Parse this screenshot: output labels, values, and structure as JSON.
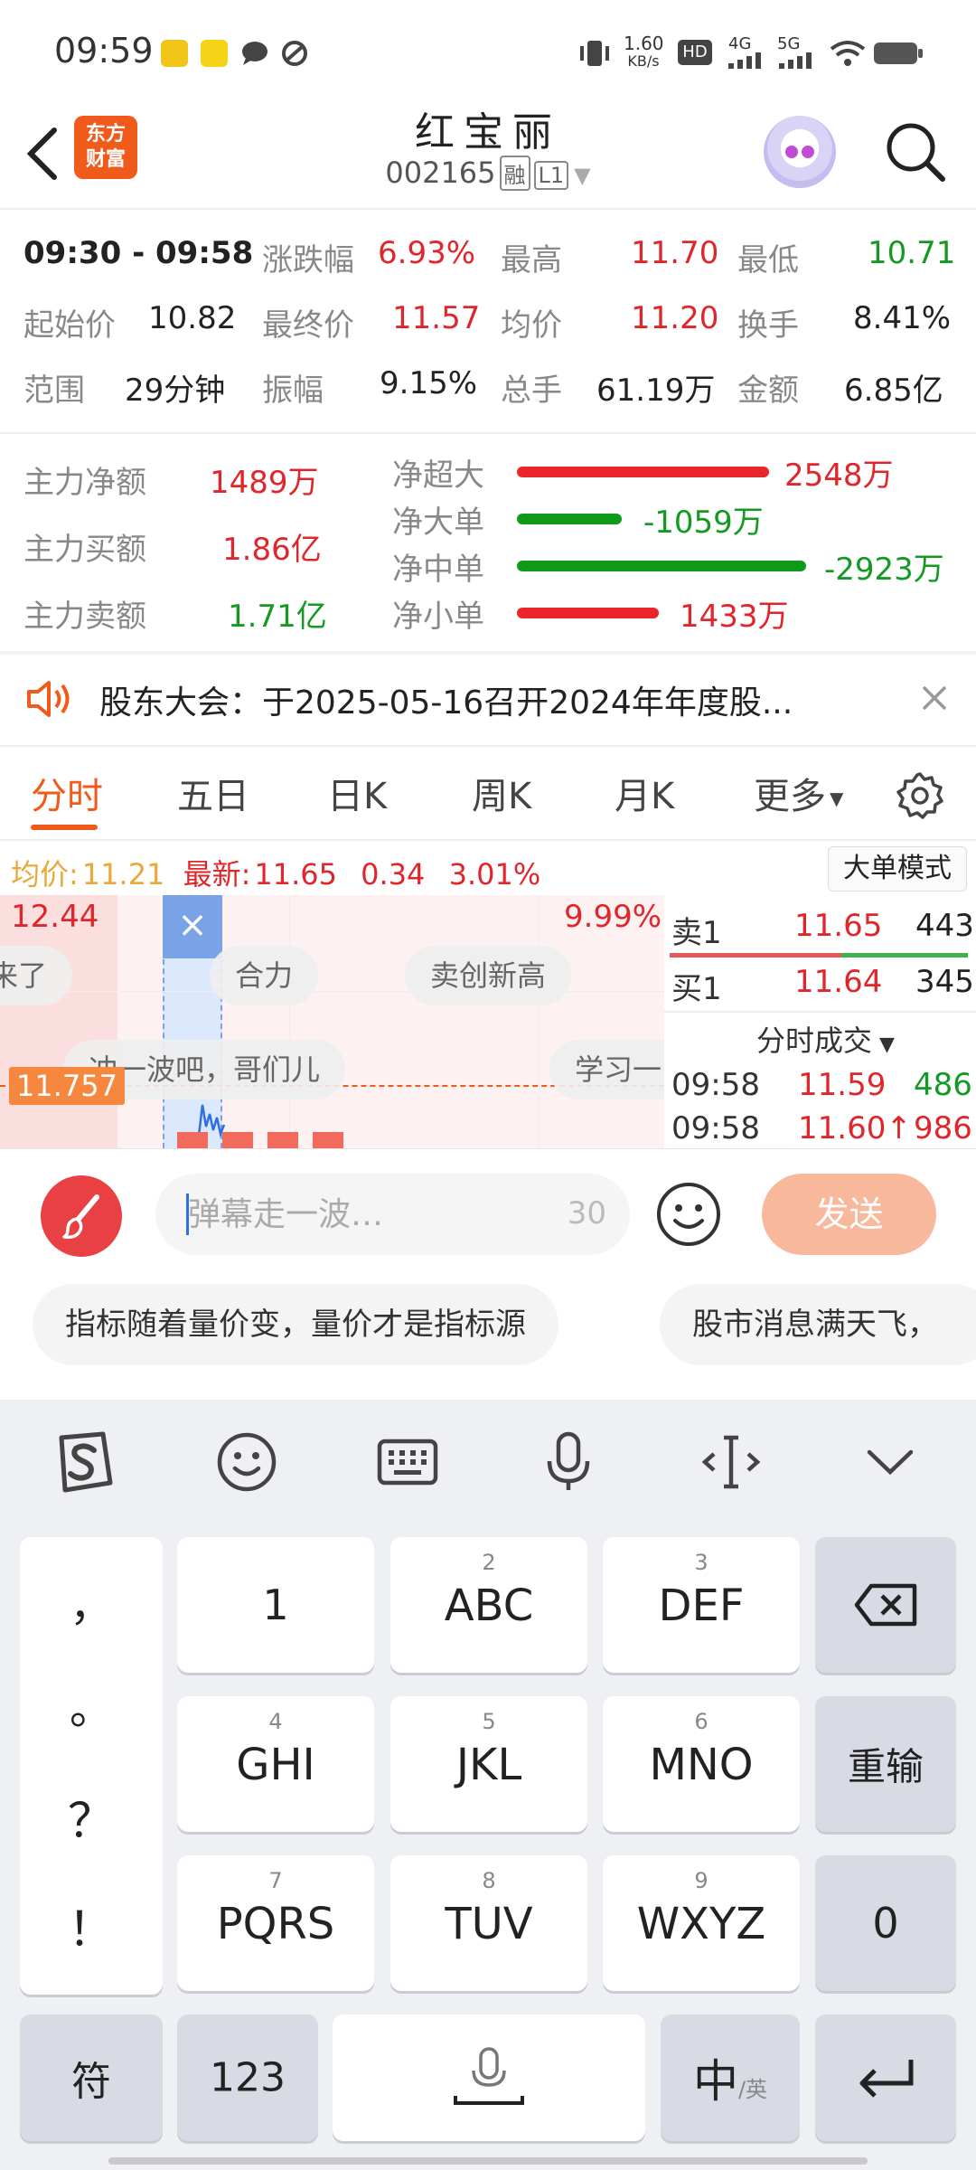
{
  "status_bar": {
    "time": "09:59",
    "net_speed": "1.60",
    "net_unit": "KB/s",
    "hd_label": "HD",
    "signal_4g": "4G",
    "signal_5g": "5G"
  },
  "header": {
    "logo_line1": "东方",
    "logo_line2": "财富",
    "stock_name": "红宝丽",
    "stock_code": "002165",
    "tag_rong": "融",
    "tag_level": "L1"
  },
  "stats": {
    "period": "09:30 - 09:58",
    "rows": [
      [
        {
          "label": "涨跌幅",
          "value": "6.93%",
          "color": "red"
        },
        {
          "label": "最高",
          "value": "11.70",
          "color": "red"
        },
        {
          "label": "最低",
          "value": "10.71",
          "color": "green"
        }
      ],
      [
        {
          "label": "起始价",
          "value": "10.82",
          "color": "dark"
        },
        {
          "label": "最终价",
          "value": "11.57",
          "color": "red"
        },
        {
          "label": "均价",
          "value": "11.20",
          "color": "red"
        },
        {
          "label": "换手",
          "value": "8.41%",
          "color": "dark"
        }
      ],
      [
        {
          "label": "范围",
          "value": "29分钟",
          "color": "dark"
        },
        {
          "label": "振幅",
          "value": "9.15%",
          "color": "dark"
        },
        {
          "label": "总手",
          "value": "61.19万",
          "color": "dark"
        },
        {
          "label": "金额",
          "value": "6.85亿",
          "color": "dark"
        }
      ]
    ]
  },
  "fund_flow": {
    "main": [
      {
        "label": "主力净额",
        "value": "1489万",
        "color": "red"
      },
      {
        "label": "主力买额",
        "value": "1.86亿",
        "color": "red"
      },
      {
        "label": "主力卖额",
        "value": "1.71亿",
        "color": "green"
      }
    ],
    "breakdown": [
      {
        "label": "净超大",
        "value": "2548万",
        "amount": 2548,
        "color": "#e8262b"
      },
      {
        "label": "净大单",
        "value": "-1059万",
        "amount": -1059,
        "color": "#109a1a"
      },
      {
        "label": "净中单",
        "value": "-2923万",
        "amount": -2923,
        "color": "#109a1a"
      },
      {
        "label": "净小单",
        "value": "1433万",
        "amount": 1433,
        "color": "#e8262b"
      }
    ]
  },
  "notice": {
    "text": "股东大会：于2025-05-16召开2024年年度股..."
  },
  "tabs": [
    {
      "label": "分时",
      "active": true
    },
    {
      "label": "五日",
      "active": false
    },
    {
      "label": "日K",
      "active": false
    },
    {
      "label": "周K",
      "active": false
    },
    {
      "label": "月K",
      "active": false
    },
    {
      "label": "更多",
      "active": false
    }
  ],
  "quote_line": {
    "avg_label": "均价:",
    "avg_value": "11.21",
    "latest_label": "最新:",
    "latest_value": "11.65",
    "change": "0.34",
    "change_pct": "3.01%",
    "mode_button": "大单模式"
  },
  "chart": {
    "top_price": "12.44",
    "top_pct": "9.99%",
    "marker_price": "11.757",
    "danmu": [
      "来了",
      "合力",
      "卖创新高",
      "冲一波吧，哥们儿",
      "学习一"
    ]
  },
  "order_book": {
    "sell": {
      "label": "卖1",
      "price": "11.65",
      "volume": "443"
    },
    "buy": {
      "label": "买1",
      "price": "11.64",
      "volume": "345"
    },
    "trades_title": "分时成交",
    "trades": [
      {
        "time": "09:58",
        "price": "11.59",
        "volume": "486",
        "vol_color": "green"
      },
      {
        "time": "09:58",
        "price": "11.60↑",
        "volume": "986",
        "vol_color": "red"
      }
    ]
  },
  "danmu_input": {
    "placeholder": "弹幕走一波…",
    "char_limit": "30",
    "send_label": "发送"
  },
  "quick_chips": [
    "指标随着量价变，量价才是指标源",
    "股市消息满天飞，"
  ],
  "keyboard": {
    "punct_keys": [
      "，",
      "。",
      "？",
      "！"
    ],
    "rows": [
      [
        {
          "num": "",
          "label": "1"
        },
        {
          "num": "2",
          "label": "ABC"
        },
        {
          "num": "3",
          "label": "DEF"
        }
      ],
      [
        {
          "num": "4",
          "label": "GHI"
        },
        {
          "num": "5",
          "label": "JKL"
        },
        {
          "num": "6",
          "label": "MNO"
        }
      ],
      [
        {
          "num": "7",
          "label": "PQRS"
        },
        {
          "num": "8",
          "label": "TUV"
        },
        {
          "num": "9",
          "label": "WXYZ"
        }
      ]
    ],
    "reenter_label": "重输",
    "zero_label": "0",
    "symbol_label": "符",
    "num_label": "123",
    "lang_label": "中",
    "lang_alt": "/英"
  },
  "colors": {
    "up": "#e0262b",
    "down": "#149a22",
    "accent": "#f05a1a",
    "avg_line": "#e8a93a"
  }
}
